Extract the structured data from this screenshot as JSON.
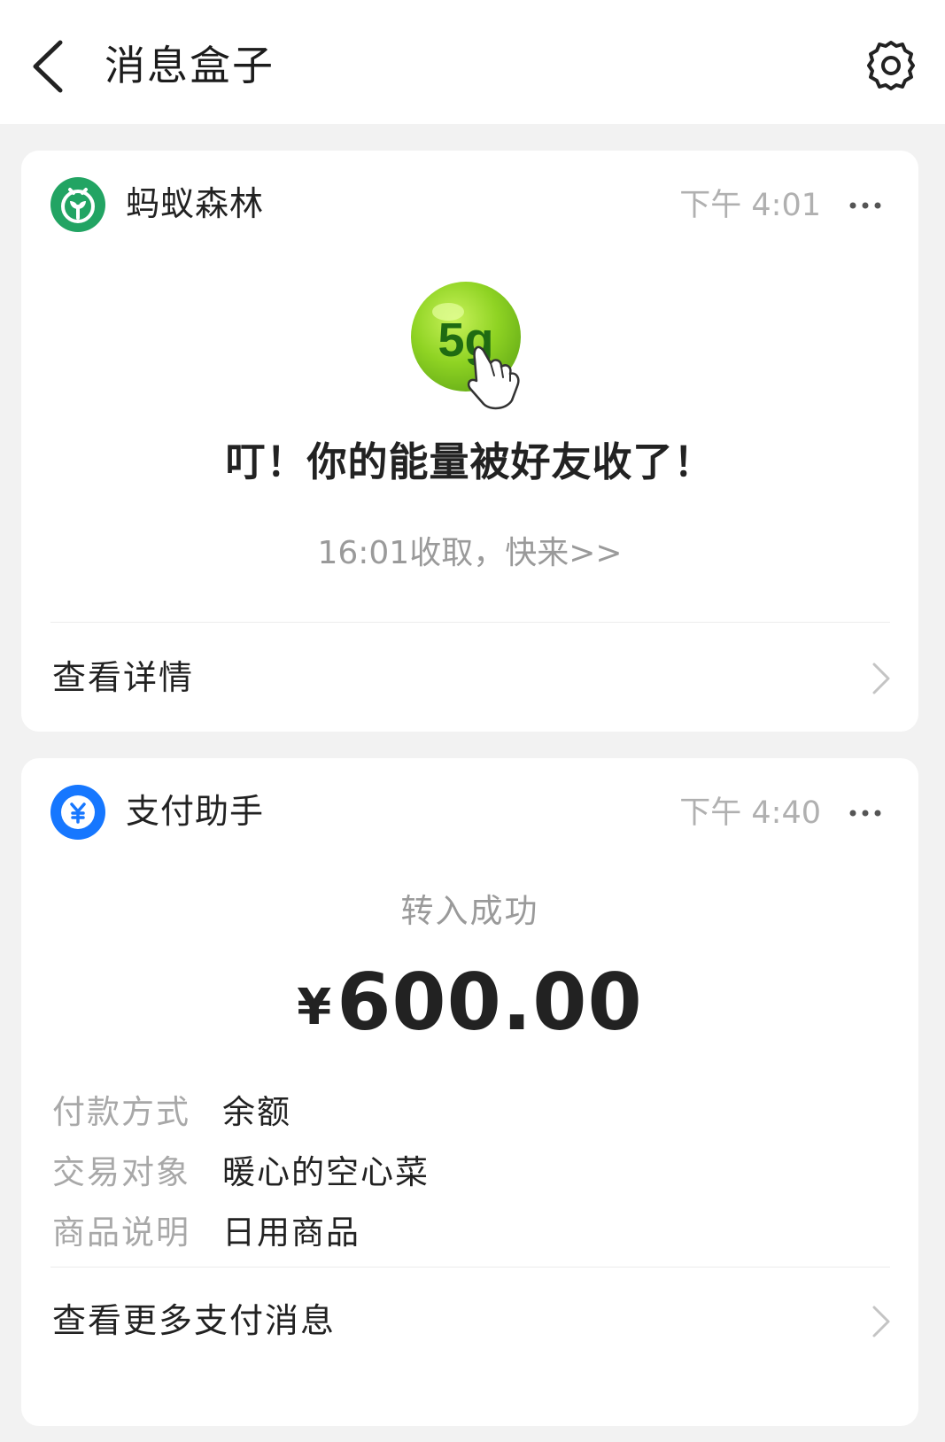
{
  "header": {
    "title": "消息盒子",
    "back_icon": "chevron-left-icon",
    "settings_icon": "gear-icon"
  },
  "forest_card": {
    "app_name": "蚂蚁森林",
    "app_icon": "ant-forest-sprout-icon",
    "time": "下午 4:01",
    "energy_label": "5g",
    "headline": "叮！你的能量被好友收了！",
    "subtext": "16:01收取，快来>>",
    "link_label": "查看详情"
  },
  "pay_card": {
    "app_name": "支付助手",
    "app_icon": "yuan-coin-icon",
    "time": "下午 4:40",
    "status": "转入成功",
    "currency_symbol": "¥",
    "amount": "600.00",
    "details": [
      {
        "label": "付款方式",
        "value": "余额"
      },
      {
        "label": "交易对象",
        "value": "暖心的空心菜"
      },
      {
        "label": "商品说明",
        "value": "日用商品"
      }
    ],
    "link_label": "查看更多支付消息"
  },
  "colors": {
    "page_bg": "#f2f2f2",
    "card_bg": "#ffffff",
    "forest_green": "#22a463",
    "pay_blue": "#1677ff",
    "energy_green": "#8fd323",
    "muted_text": "#9a9a9a"
  }
}
